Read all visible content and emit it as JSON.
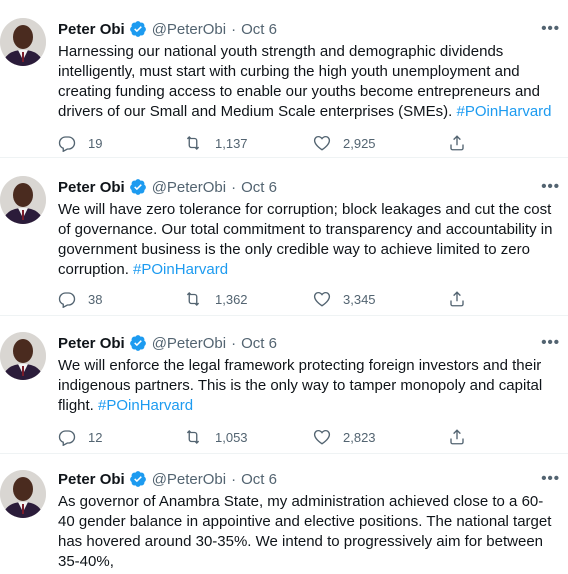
{
  "author": {
    "name": "Peter Obi",
    "handle": "@PeterObi",
    "separator": "·",
    "verified": true
  },
  "colors": {
    "link": "#1d9bf0",
    "secondary_text": "#536471",
    "verified_badge": "#1d9bf0"
  },
  "icons": {
    "reply": "reply-icon",
    "retweet": "retweet-icon",
    "like": "heart-icon",
    "share": "share-icon",
    "more": "more-options-icon"
  },
  "tweets": [
    {
      "date": "Oct 6",
      "text": "Harnessing our national youth strength and demographic dividends intelligently, must start with curbing the high youth unemployment and creating funding access to enable our youths become entrepreneurs and drivers of our Small and Medium Scale enterprises (SMEs). ",
      "hashtag": "#POinHarvard",
      "replies": "19",
      "retweets": "1,137",
      "likes": "2,925"
    },
    {
      "date": "Oct 6",
      "text": "We will have zero tolerance for corruption; block leakages and cut the cost of governance. Our total commitment to transparency and accountability in government business is the only credible way to achieve limited to zero corruption. ",
      "hashtag": "#POinHarvard",
      "replies": "38",
      "retweets": "1,362",
      "likes": "3,345"
    },
    {
      "date": "Oct 6",
      "text": "We will enforce the legal framework protecting foreign investors and their indigenous partners. This is the only way to tamper monopoly and capital flight. ",
      "hashtag": "#POinHarvard",
      "replies": "12",
      "retweets": "1,053",
      "likes": "2,823"
    },
    {
      "date": "Oct 6",
      "text": "As governor of Anambra State, my administration achieved close to a 60-40 gender balance in appointive and elective positions. The national target has hovered around 30-35%. We intend to progressively aim for between 35-40%,",
      "hashtag": "",
      "replies": "",
      "retweets": "",
      "likes": ""
    }
  ],
  "more_label": "•••"
}
